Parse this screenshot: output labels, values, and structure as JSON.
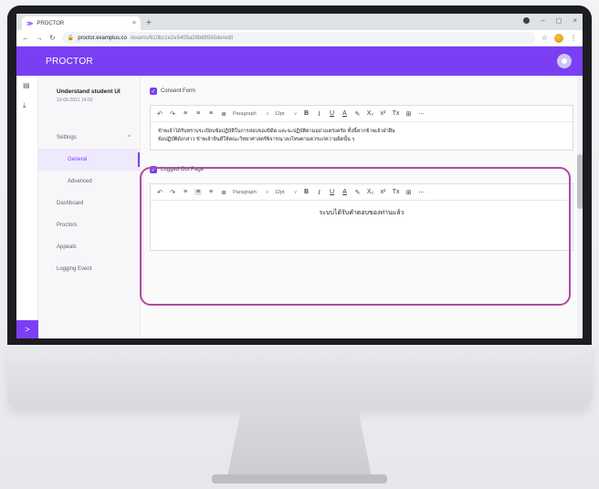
{
  "browser": {
    "tab_title": "PROCTOR",
    "tab_close": "×",
    "new_tab": "+",
    "url_host": "proctor.examplus.co",
    "url_path": "/exams/610bc1e2e5405a26b68585de/edit",
    "window_minimize": "–",
    "window_maximize": "◻",
    "window_close": "×"
  },
  "app": {
    "brand": "PROCTOR",
    "accent_color": "#7a3ff2"
  },
  "exam": {
    "title": "Understand student UI",
    "date": "10-09-2021 14:00"
  },
  "sidebar": {
    "settings_label": "Settings",
    "general_label": "General",
    "advanced_label": "Advanced",
    "items": [
      {
        "label": "Dashboard"
      },
      {
        "label": "Proctors"
      },
      {
        "label": "Appeals"
      },
      {
        "label": "Logging Event"
      }
    ],
    "expand_label": ">"
  },
  "toolbar": {
    "paragraph": "Paragraph",
    "font_size": "12pt",
    "bold": "B",
    "italic": "I",
    "underline": "U",
    "text_color": "A",
    "subscript": "X₂",
    "superscript": "x²",
    "clear_format": "Tx",
    "more": "⋯"
  },
  "consent": {
    "label": "Consent Form",
    "checked": true,
    "text_line1": "ข้าพเจ้าได้รับทราบระเบียบข้อปฏิบัติในการสอบของบิดิด และจะปฏิบัติตามอย่างเคร่งครัด ทั้งนี้หากข้าพเจ้าฝ่าฝืน",
    "text_line2": "ข้อปฏิบัติดังกล่าว ข้าพเจ้ายินดีให้คณะวิทยาศาสตร์พิจารณาลงโทษตามควรแก่ความผิดนั้น ๆ"
  },
  "logged_out": {
    "label": "Logged Out Page",
    "checked": true,
    "text": "ระบบได้รับคำตอบของท่านแล้ว"
  }
}
